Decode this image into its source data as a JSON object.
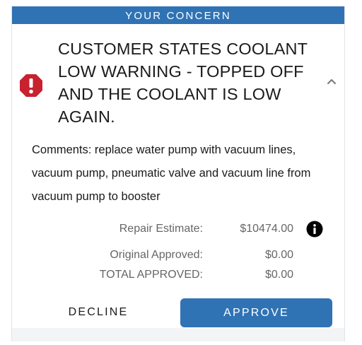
{
  "header": {
    "title": "YOUR CONCERN"
  },
  "concern": {
    "icon": "alert-octagon-icon",
    "text": "CUSTOMER STATES COOLANT LOW WARNING - TOPPED OFF AND THE COOLANT IS LOW AGAIN.",
    "toggle_icon": "chevron-up-icon",
    "comments": "Comments: replace water pump with vacuum lines, vacuum pump, pneumatic valve and vacuum line from vacuum pump to booster"
  },
  "pricing": {
    "repair_estimate_label": "Repair Estimate:",
    "repair_estimate_value": "$10474.00",
    "original_approved_label": "Original Approved:",
    "original_approved_value": "$0.00",
    "total_approved_label": "TOTAL APPROVED:",
    "total_approved_value": "$0.00",
    "info_icon": "info-icon"
  },
  "actions": {
    "decline_label": "DECLINE",
    "approve_label": "APPROVE"
  },
  "colors": {
    "brand_blue": "#2f73b5",
    "alert_red": "#c8212f"
  }
}
